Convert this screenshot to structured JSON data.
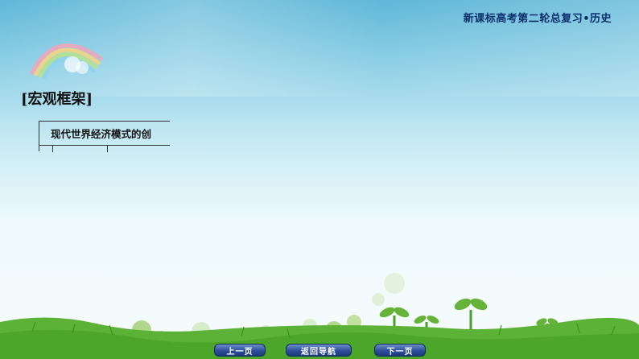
{
  "header": {
    "course_title": "新课标高考第二轮总复习•历史"
  },
  "section": {
    "title": "[宏观框架]"
  },
  "framework": {
    "top_label": "现代世界经济模式的创"
  },
  "navigation": {
    "prev_label": "上一页",
    "home_label": "返回导航",
    "next_label": "下一页"
  },
  "colors": {
    "header_text": "#0a2f6b",
    "button_blue": "#2c4f9a",
    "grass_green": "#4caf2e"
  },
  "icons": {
    "decoration": "rainbow-icon",
    "background": "grass-sprouts-illustration"
  }
}
